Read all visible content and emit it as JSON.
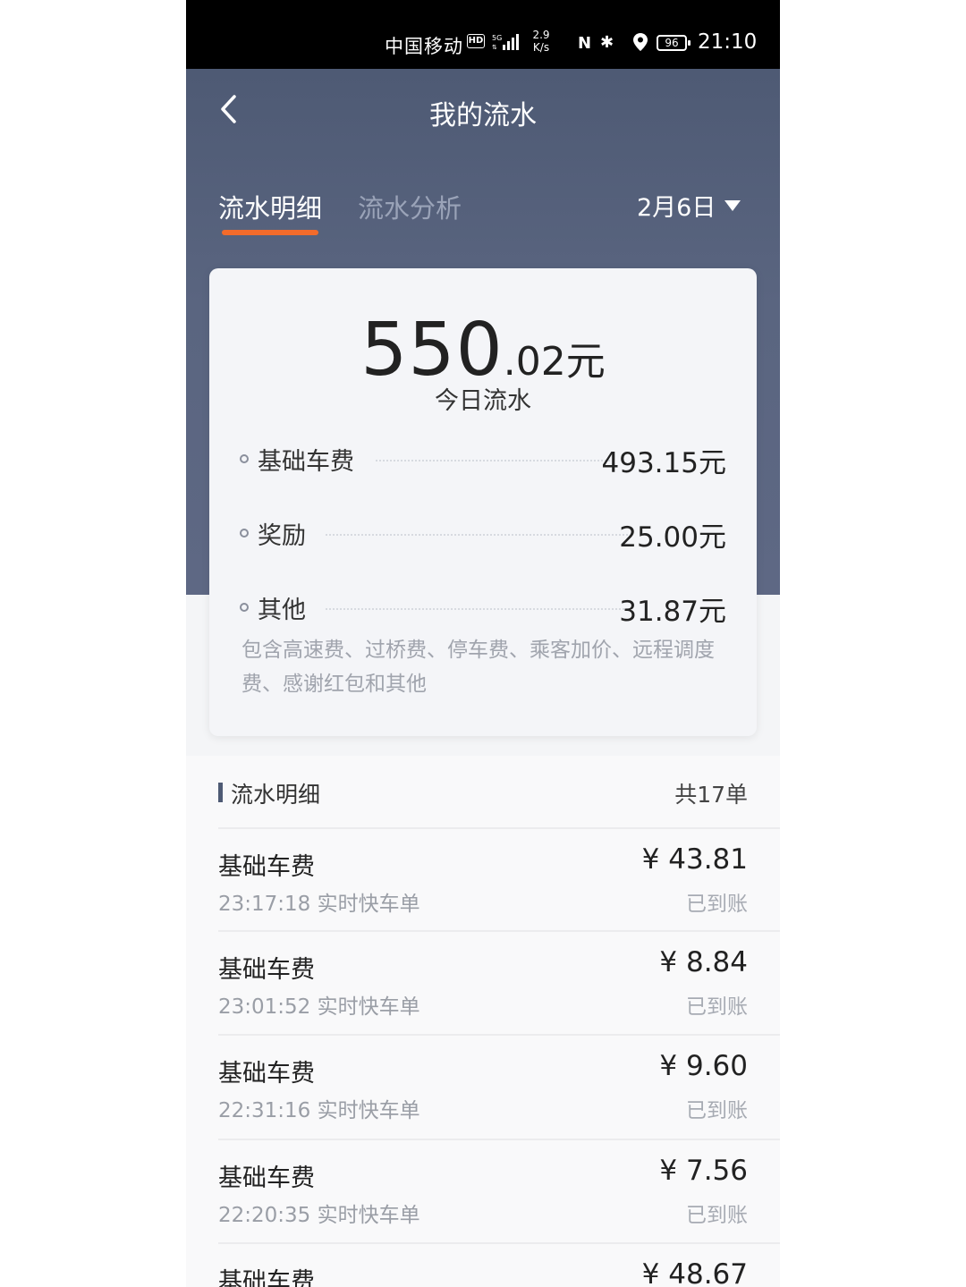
{
  "status_bar": {
    "carrier": "中国移动",
    "hd": "HD",
    "speed_value": "2.9",
    "speed_unit": "K/s",
    "nfc": "N",
    "bluetooth": "✱",
    "battery": "96",
    "time": "21:10"
  },
  "header": {
    "title": "我的流水"
  },
  "tabs": [
    {
      "label": "流水明细"
    },
    {
      "label": "流水分析"
    }
  ],
  "date_filter": "2月6日",
  "summary": {
    "total_integer": "550",
    "total_decimal": ".02元",
    "total_label": "今日流水",
    "rows": [
      {
        "label": "基础车费",
        "value": "493.15元"
      },
      {
        "label": "奖励",
        "value": "25.00元"
      },
      {
        "label": "其他",
        "value": "31.87元"
      }
    ],
    "note": "包含高速费、过桥费、停车费、乘客加价、远程调度费、感谢红包和其他"
  },
  "details": {
    "title": "流水明细",
    "count": "共17单",
    "items": [
      {
        "name": "基础车费",
        "time_type": "23:17:18 实时快车单",
        "amount": "¥ 43.81",
        "status": "已到账"
      },
      {
        "name": "基础车费",
        "time_type": "23:01:52 实时快车单",
        "amount": "¥ 8.84",
        "status": "已到账"
      },
      {
        "name": "基础车费",
        "time_type": "22:31:16 实时快车单",
        "amount": "¥ 9.60",
        "status": "已到账"
      },
      {
        "name": "基础车费",
        "time_type": "22:20:35 实时快车单",
        "amount": "¥ 7.56",
        "status": "已到账"
      },
      {
        "name": "基础车费",
        "time_type": "",
        "amount": "¥ 48.67",
        "status": ""
      }
    ]
  }
}
